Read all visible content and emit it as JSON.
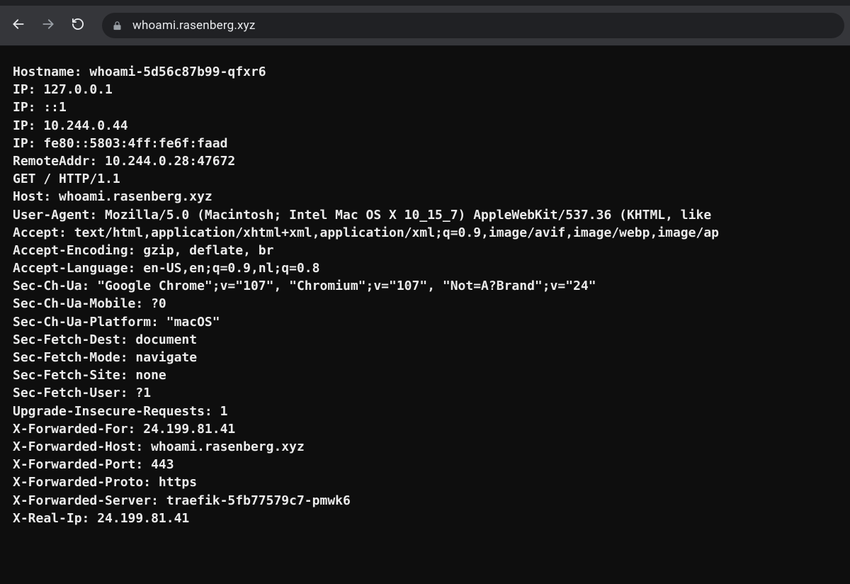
{
  "browser": {
    "url": "whoami.rasenberg.xyz"
  },
  "response": {
    "lines": [
      "Hostname: whoami-5d56c87b99-qfxr6",
      "IP: 127.0.0.1",
      "IP: ::1",
      "IP: 10.244.0.44",
      "IP: fe80::5803:4ff:fe6f:faad",
      "RemoteAddr: 10.244.0.28:47672",
      "GET / HTTP/1.1",
      "Host: whoami.rasenberg.xyz",
      "User-Agent: Mozilla/5.0 (Macintosh; Intel Mac OS X 10_15_7) AppleWebKit/537.36 (KHTML, like ",
      "Accept: text/html,application/xhtml+xml,application/xml;q=0.9,image/avif,image/webp,image/ap",
      "Accept-Encoding: gzip, deflate, br",
      "Accept-Language: en-US,en;q=0.9,nl;q=0.8",
      "Sec-Ch-Ua: \"Google Chrome\";v=\"107\", \"Chromium\";v=\"107\", \"Not=A?Brand\";v=\"24\"",
      "Sec-Ch-Ua-Mobile: ?0",
      "Sec-Ch-Ua-Platform: \"macOS\"",
      "Sec-Fetch-Dest: document",
      "Sec-Fetch-Mode: navigate",
      "Sec-Fetch-Site: none",
      "Sec-Fetch-User: ?1",
      "Upgrade-Insecure-Requests: 1",
      "X-Forwarded-For: 24.199.81.41",
      "X-Forwarded-Host: whoami.rasenberg.xyz",
      "X-Forwarded-Port: 443",
      "X-Forwarded-Proto: https",
      "X-Forwarded-Server: traefik-5fb77579c7-pmwk6",
      "X-Real-Ip: 24.199.81.41"
    ]
  }
}
